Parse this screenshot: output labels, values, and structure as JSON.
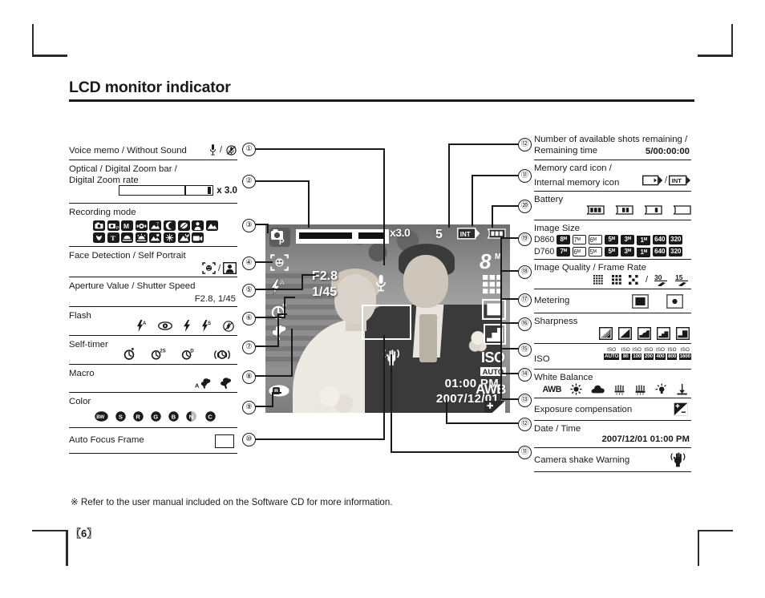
{
  "page": {
    "title": "LCD monitor indicator",
    "footnote": "※ Refer to the user manual included on the Software CD for more information.",
    "page_number": "〖6〗"
  },
  "left_rows": [
    {
      "num": "①",
      "label": "Voice memo / Without Sound",
      "icons": "mic / mic-muted"
    },
    {
      "num": "②",
      "label_line1": "Optical / Digital Zoom bar /",
      "label_line2": "Digital Zoom rate",
      "value": "x 3.0"
    },
    {
      "num": "③",
      "label": "Recording mode",
      "icons": "16 mode pictograms"
    },
    {
      "num": "④",
      "label": "Face Detection / Self Portrait",
      "icons": "face-detect / self-portrait"
    },
    {
      "num": "⑤",
      "label": "Aperture Value / Shutter Speed",
      "value": "F2.8, 1/45"
    },
    {
      "num": "⑥",
      "label": "Flash",
      "icons": "auto-flash, red-eye, fill-flash, slow-sync, flash-off"
    },
    {
      "num": "⑦",
      "label": "Self-timer",
      "icons": "10sec, 2sec, double, motion-timer"
    },
    {
      "num": "⑧",
      "label": "Macro",
      "icons": "auto-macro, macro"
    },
    {
      "num": "⑨",
      "label": "Color",
      "icons": "BW, S, R, G, B, Negative, Custom"
    },
    {
      "num": "⑩",
      "label": "Auto Focus Frame",
      "icons": "af-frame"
    }
  ],
  "right_rows": [
    {
      "num": "⑫",
      "label_line1": "Number of available shots remaining /",
      "label_line2": "Remaining time",
      "value": "5/00:00:00"
    },
    {
      "num": "⑪",
      "label_line1": "Memory card icon /",
      "label_line2": "Internal memory icon",
      "icons": "card / INT"
    },
    {
      "num": "⑩⃝",
      "num_text": "⑳",
      "label": "Battery",
      "icons": "battery-full, battery-two, battery-one, battery-empty"
    },
    {
      "num": "⑲",
      "label": "Image Size",
      "models": [
        {
          "name": "D860",
          "sizes": [
            "8ᴹ",
            "7ᴹ",
            "6ᴹ",
            "5ᴹ",
            "3ᴹ",
            "1ᴹ",
            "640",
            "320"
          ]
        },
        {
          "name": "D760",
          "sizes": [
            "7ᴹ",
            "6ᴹ",
            "5ᴹ",
            "5ᴹ",
            "3ᴹ",
            "1ᴹ",
            "640",
            "320"
          ]
        }
      ]
    },
    {
      "num": "⑱",
      "label": "Image Quality / Frame Rate",
      "icons": "super-fine, fine, normal / 30fps, 15fps"
    },
    {
      "num": "⑰",
      "label": "Metering",
      "icons": "multi, spot"
    },
    {
      "num": "⑯",
      "label": "Sharpness",
      "icons": "soft+, soft, normal, vivid, vivid+"
    },
    {
      "num": "⑮",
      "label": "ISO",
      "iso_values": [
        "AUTO",
        "80",
        "100",
        "200",
        "400",
        "800",
        "1600"
      ]
    },
    {
      "num": "⑭",
      "label": "White Balance",
      "icons": "AWB, daylight, cloudy, fluorescent-h, fluorescent-l, tungsten, custom"
    },
    {
      "num": "⑬",
      "label": "Exposure compensation",
      "icons": "ev-compensation"
    },
    {
      "num": "⑫⃝",
      "num_text": "⑫",
      "label": "Date / Time",
      "value": "2007/12/01  01:00 PM"
    },
    {
      "num": "⑪",
      "label": "Camera shake Warning",
      "icons": "shake-warning"
    }
  ],
  "lcd": {
    "mode_badge": "P",
    "zoom_rate": "x3.0",
    "shots_remaining": "5",
    "memory_badge": "INT",
    "aperture": "F2.8",
    "shutter": "1/45",
    "iso_label": "ISO",
    "iso_value": "AUTO",
    "white_balance": "AWB",
    "image_size": "8",
    "image_size_unit": "M",
    "time": "01:00 PM",
    "date": "2007/12/01"
  },
  "callout_numbers_left": [
    "①",
    "②",
    "③",
    "④",
    "⑤",
    "⑥",
    "⑦",
    "⑧",
    "⑨",
    "⑩"
  ],
  "callout_numbers_right": [
    "⑫",
    "⑪",
    "⑳",
    "⑲",
    "⑱",
    "⑰",
    "⑯",
    "⑮",
    "⑭",
    "⑬",
    "⑫",
    "⑪"
  ],
  "colors": {
    "ink": "#1a1a1a",
    "paper": "#ffffff",
    "osd": "#ffffff"
  }
}
